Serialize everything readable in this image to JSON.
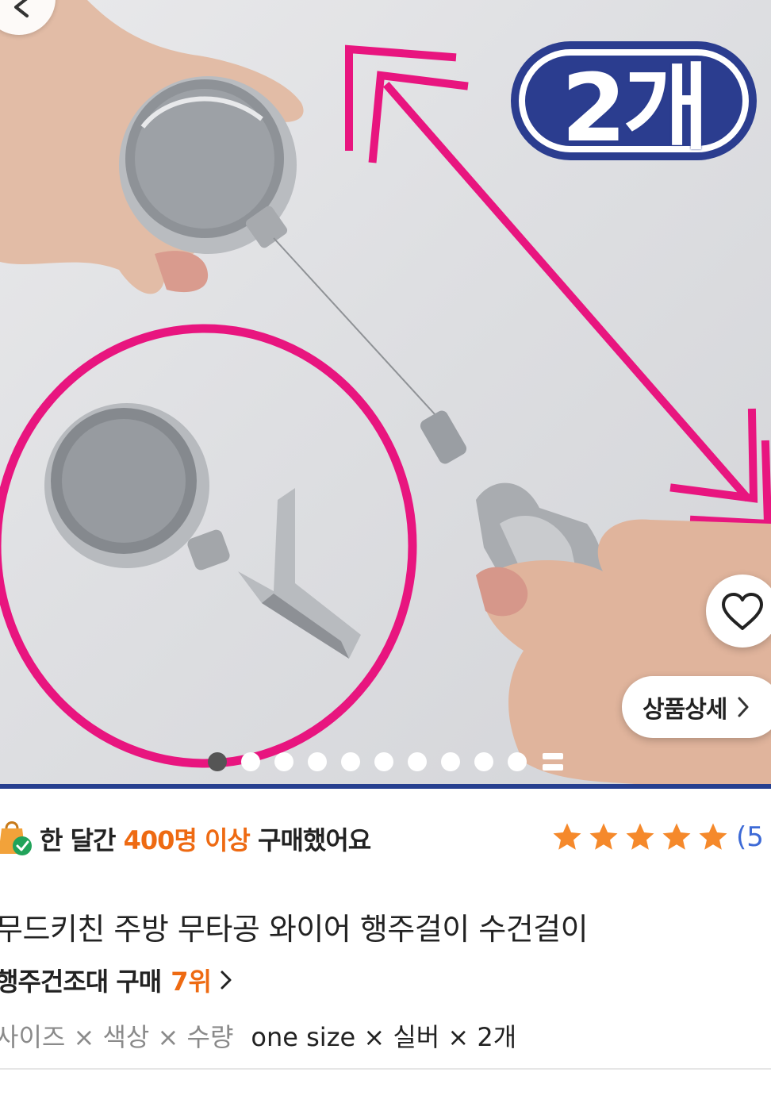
{
  "hero": {
    "quantity_badge": "2개",
    "detail_button_label": "상품상세",
    "image_count": 10,
    "active_index": 0
  },
  "purchase": {
    "prefix": "한 달간",
    "highlight": "400명 이상",
    "suffix": "구매했어요"
  },
  "rating": {
    "stars": 5,
    "review_count_visible": "(5"
  },
  "product": {
    "title": "무드키친 주방 무타공 와이어 행주걸이 수건걸이",
    "category": "행주건조대 구매",
    "rank": "7위"
  },
  "options": {
    "label": "사이즈 × 색상 × 수량",
    "value": "one size × 실버 × 2개"
  },
  "colors": {
    "accent_orange": "#ee6a12",
    "star_orange": "#f5892b",
    "link_blue": "#3d6ad6",
    "magenta": "#e8157f",
    "badge_navy": "#2b3d8f"
  }
}
